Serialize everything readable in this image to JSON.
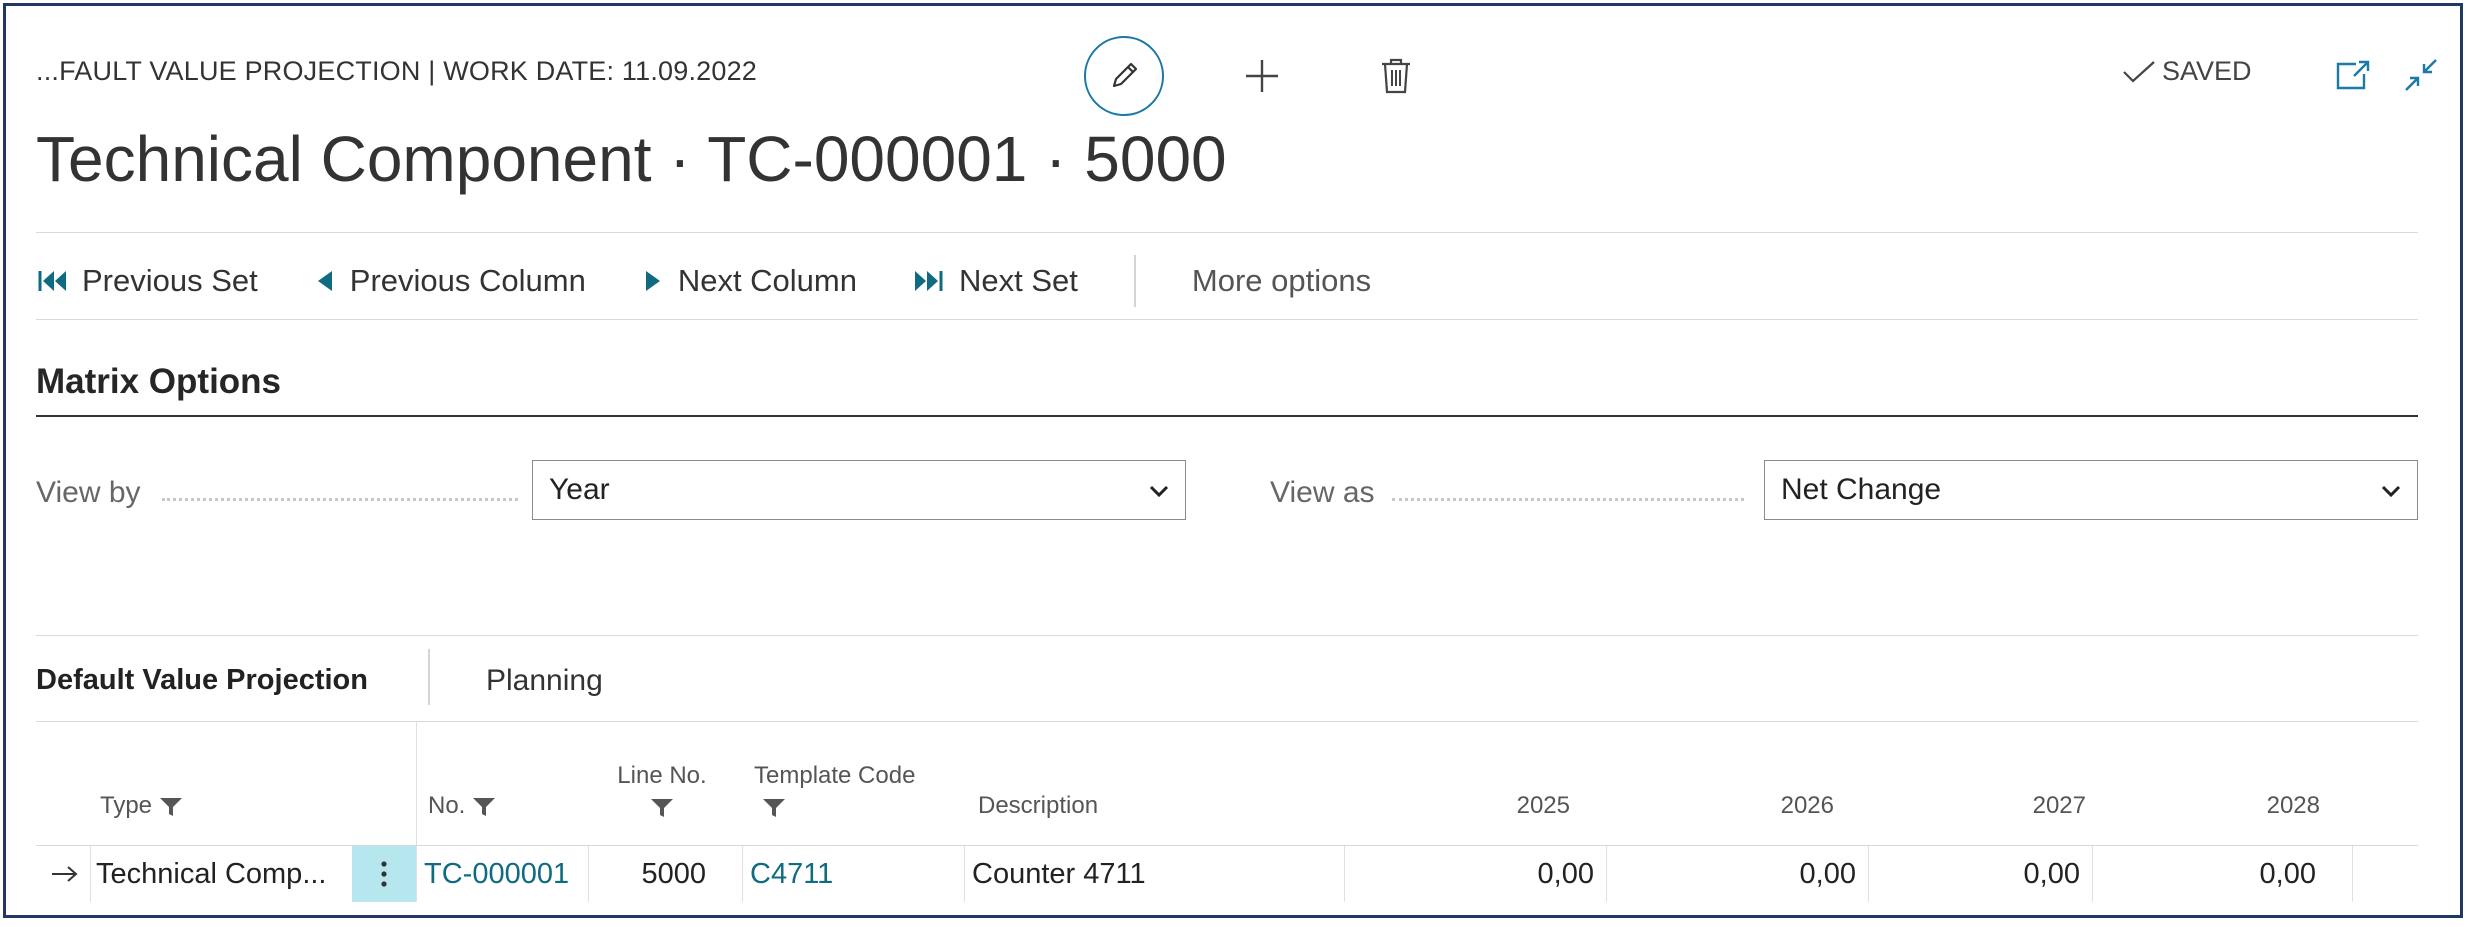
{
  "header": {
    "caption": "...FAULT VALUE PROJECTION | WORK DATE: 11.09.2022",
    "title": "Technical Component · TC-000001 · 5000",
    "saved_label": "SAVED",
    "icons": [
      "edit-pencil-icon",
      "plus-icon",
      "trash-icon",
      "checkmark-icon",
      "open-in-new-window-icon",
      "collapse-icon"
    ]
  },
  "actions": {
    "previous_set": "Previous Set",
    "previous_column": "Previous Column",
    "next_column": "Next Column",
    "next_set": "Next Set",
    "more_options": "More options"
  },
  "matrix_options": {
    "title": "Matrix Options",
    "view_by_label": "View by",
    "view_by_value": "Year",
    "view_as_label": "View as",
    "view_as_value": "Net Change"
  },
  "tabs": {
    "active": "Default Value Projection",
    "other": "Planning"
  },
  "table": {
    "columns": {
      "type": "Type",
      "no": "No.",
      "line_no": "Line No.",
      "template_code": "Template Code",
      "description": "Description",
      "y2025": "2025",
      "y2026": "2026",
      "y2027": "2027",
      "y2028": "2028"
    },
    "rows": [
      {
        "type": "Technical Comp...",
        "no": "TC-000001",
        "line_no": "5000",
        "template_code": "C4711",
        "description": "Counter 4711",
        "y2025": "0,00",
        "y2026": "0,00",
        "y2027": "0,00",
        "y2028": "0,00"
      }
    ]
  },
  "colors": {
    "accent": "#0f6b80",
    "frame": "#1f3864",
    "selected_cell": "#b6e6ee"
  }
}
